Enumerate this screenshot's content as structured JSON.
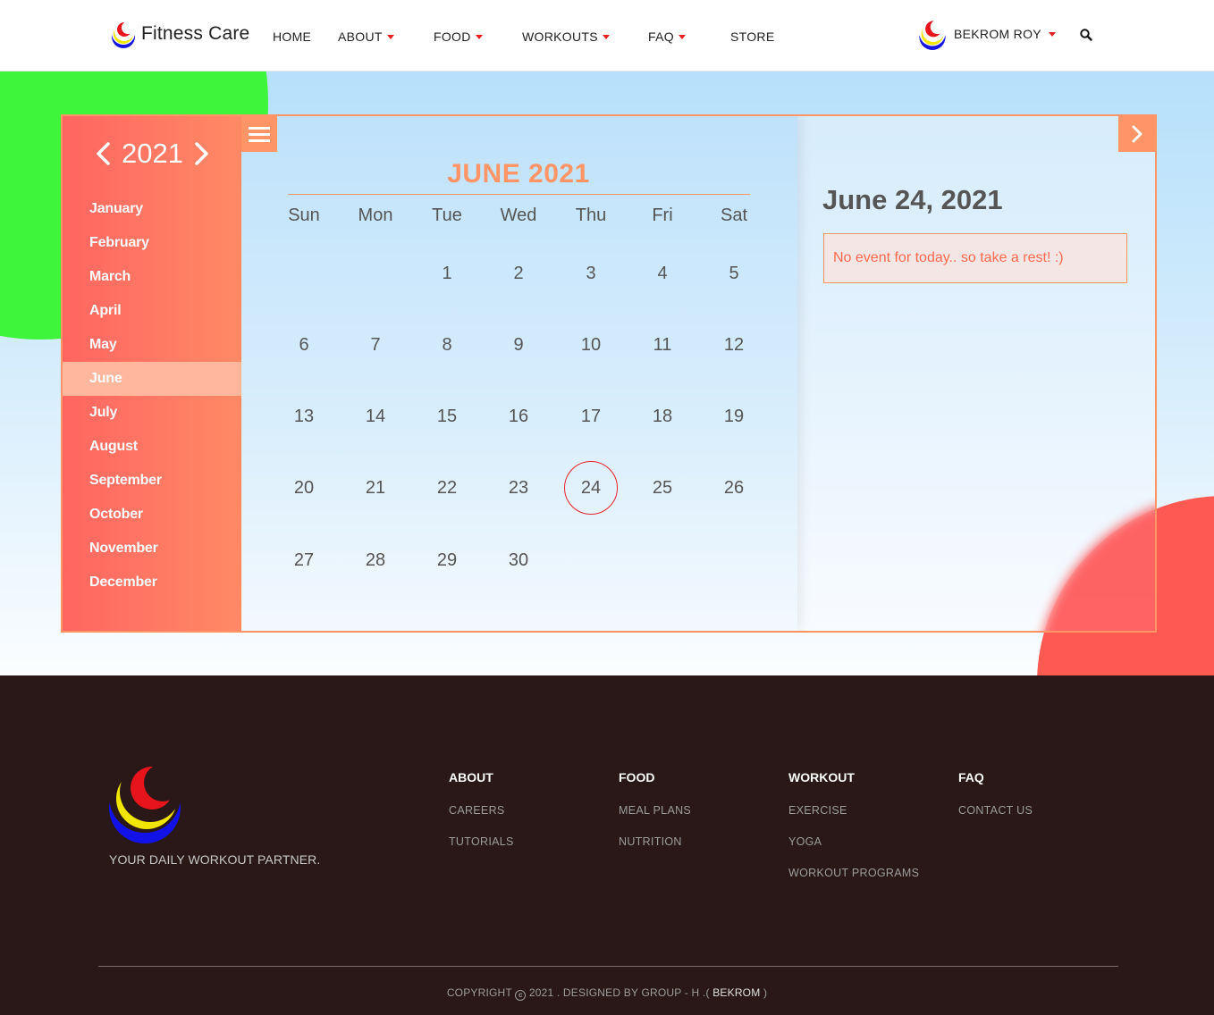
{
  "nav": {
    "brand": "Fitness Care",
    "items": [
      {
        "label": "HOME",
        "caret": false
      },
      {
        "label": "ABOUT",
        "caret": true
      },
      {
        "label": "FOOD",
        "caret": true
      },
      {
        "label": "WORKOUTS",
        "caret": true
      },
      {
        "label": "FAQ",
        "caret": true
      },
      {
        "label": "STORE",
        "caret": false
      }
    ],
    "user": "BEKROM ROY",
    "search_icon": "search-icon"
  },
  "calendar": {
    "year": "2021",
    "months": [
      "January",
      "February",
      "March",
      "April",
      "May",
      "June",
      "July",
      "August",
      "September",
      "October",
      "November",
      "December"
    ],
    "active_month": "June",
    "title": "JUNE 2021",
    "weekdays": [
      "Sun",
      "Mon",
      "Tue",
      "Wed",
      "Thu",
      "Fri",
      "Sat"
    ],
    "weeks": [
      [
        "",
        "",
        "1",
        "2",
        "3",
        "4",
        "5"
      ],
      [
        "6",
        "7",
        "8",
        "9",
        "10",
        "11",
        "12"
      ],
      [
        "13",
        "14",
        "15",
        "16",
        "17",
        "18",
        "19"
      ],
      [
        "20",
        "21",
        "22",
        "23",
        "24",
        "25",
        "26"
      ],
      [
        "27",
        "28",
        "29",
        "30",
        "",
        "",
        ""
      ]
    ],
    "selected_day": "24",
    "selected_date": "June 24, 2021",
    "event_message": "No event for today.. so take a rest! :)"
  },
  "footer": {
    "tagline": "YOUR DAILY WORKOUT PARTNER.",
    "columns": [
      {
        "heading": "ABOUT",
        "links": [
          "CAREERS",
          "TUTORIALS"
        ]
      },
      {
        "heading": "FOOD",
        "links": [
          "MEAL PLANS",
          "NUTRITION"
        ]
      },
      {
        "heading": "WORKOUT",
        "links": [
          "EXERCISE",
          "YOGA",
          "WORKOUT PROGRAMS"
        ]
      },
      {
        "heading": "FAQ",
        "links": [
          "CONTACT US"
        ]
      }
    ],
    "copyright_prefix": "COPYRIGHT",
    "copyright_suffix": "2021 . DESIGNED BY GROUP - H .(",
    "designer": "BEKROM",
    "copyright_close": ")"
  },
  "colors": {
    "accent": "#ff9566",
    "sidebar_start": "#ff6560",
    "sidebar_end": "#ff8a66",
    "today_ring": "#e8232b",
    "footer_bg": "#2a1717",
    "nav_caret": "#e62020"
  }
}
